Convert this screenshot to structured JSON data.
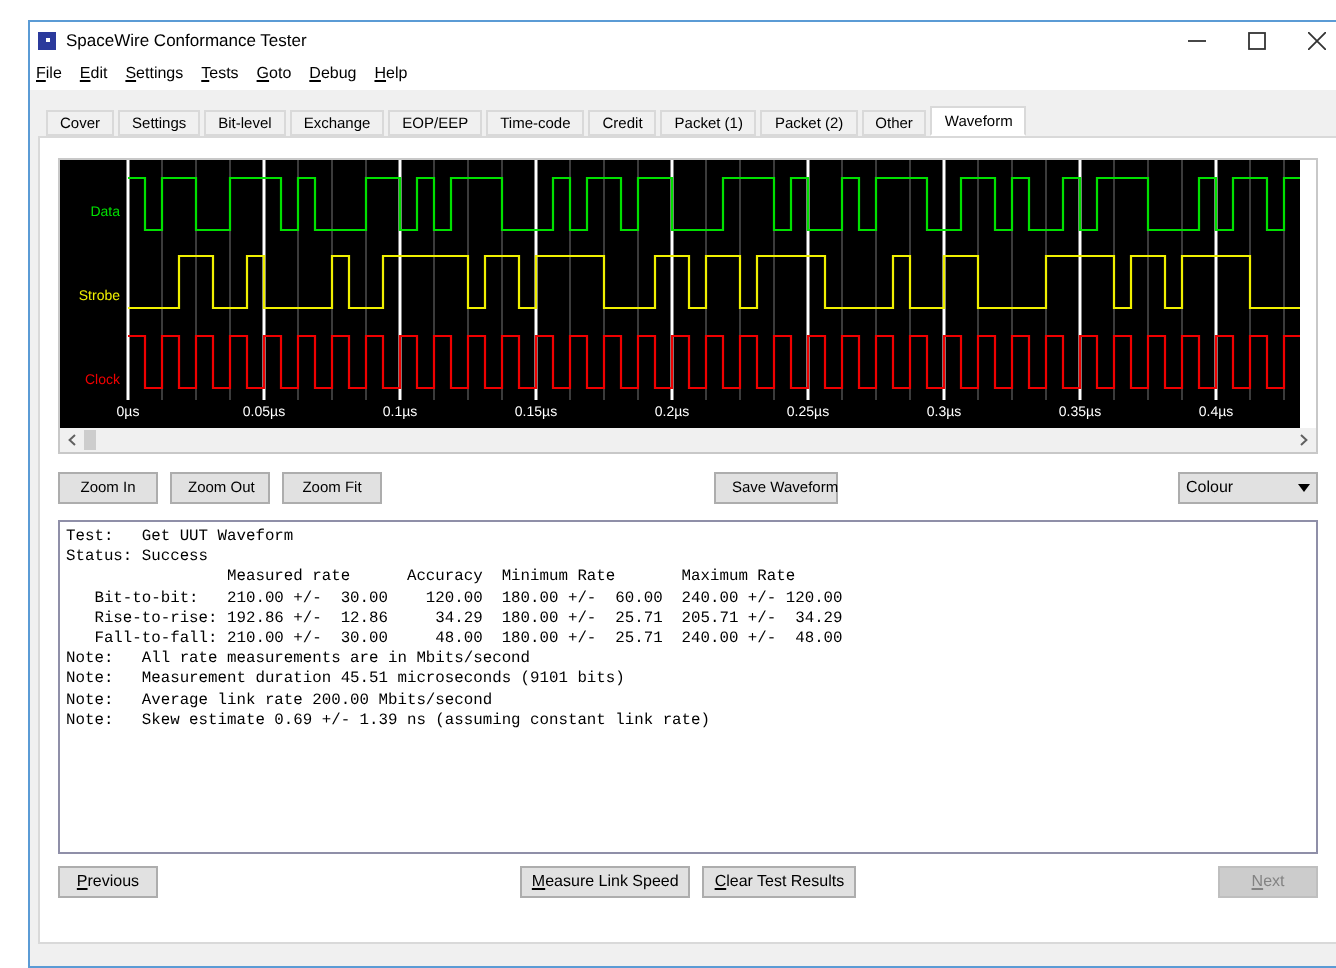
{
  "window": {
    "title": "SpaceWire Conformance Tester"
  },
  "menu": [
    "File",
    "Edit",
    "Settings",
    "Tests",
    "Goto",
    "Debug",
    "Help"
  ],
  "tabs": [
    {
      "label": "Cover",
      "selected": false
    },
    {
      "label": "Settings",
      "selected": false
    },
    {
      "label": "Bit-level",
      "selected": false
    },
    {
      "label": "Exchange",
      "selected": false
    },
    {
      "label": "EOP/EEP",
      "selected": false
    },
    {
      "label": "Time-code",
      "selected": false
    },
    {
      "label": "Credit",
      "selected": false
    },
    {
      "label": "Packet (1)",
      "selected": false
    },
    {
      "label": "Packet (2)",
      "selected": false
    },
    {
      "label": "Other",
      "selected": false
    },
    {
      "label": "Waveform",
      "selected": true
    }
  ],
  "waveform": {
    "signals": [
      {
        "name": "Data",
        "color": "#00e000"
      },
      {
        "name": "Strobe",
        "color": "#f0f000"
      },
      {
        "name": "Clock",
        "color": "#f00000"
      }
    ],
    "time_ticks": [
      "0µs",
      "0.05µs",
      "0.1µs",
      "0.15µs",
      "0.2µs",
      "0.25µs",
      "0.3µs",
      "0.35µs",
      "0.4µs"
    ]
  },
  "toolbar": {
    "left_buttons": [
      "Zoom In",
      "Zoom Out",
      "Zoom Fit"
    ],
    "center_button": "Save Waveform",
    "colour_select": "Colour"
  },
  "results": [
    "Test:   Get UUT Waveform",
    "Status: Success",
    "                 Measured rate      Accuracy  Minimum Rate       Maximum Rate",
    "   Bit-to-bit:   210.00 +/-  30.00    120.00  180.00 +/-  60.00  240.00 +/- 120.00",
    "   Rise-to-rise: 192.86 +/-  12.86     34.29  180.00 +/-  25.71  205.71 +/-  34.29",
    "   Fall-to-fall: 210.00 +/-  30.00     48.00  180.00 +/-  25.71  240.00 +/-  48.00",
    "Note:   All rate measurements are in Mbits/second",
    "Note:   Measurement duration 45.51 microseconds (9101 bits)",
    "Note:   Average link rate 200.00 Mbits/second",
    "Note:   Skew estimate 0.69 +/- 1.39 ns (assuming constant link rate)"
  ],
  "bottom_buttons": [
    {
      "label": "Previous",
      "disabled": false,
      "kind": "left"
    },
    {
      "label": "Measure Link Speed",
      "disabled": false,
      "kind": "center"
    },
    {
      "label": "Clear Test Results",
      "disabled": false,
      "kind": "center"
    },
    {
      "label": "Next",
      "disabled": true,
      "kind": "right"
    }
  ]
}
